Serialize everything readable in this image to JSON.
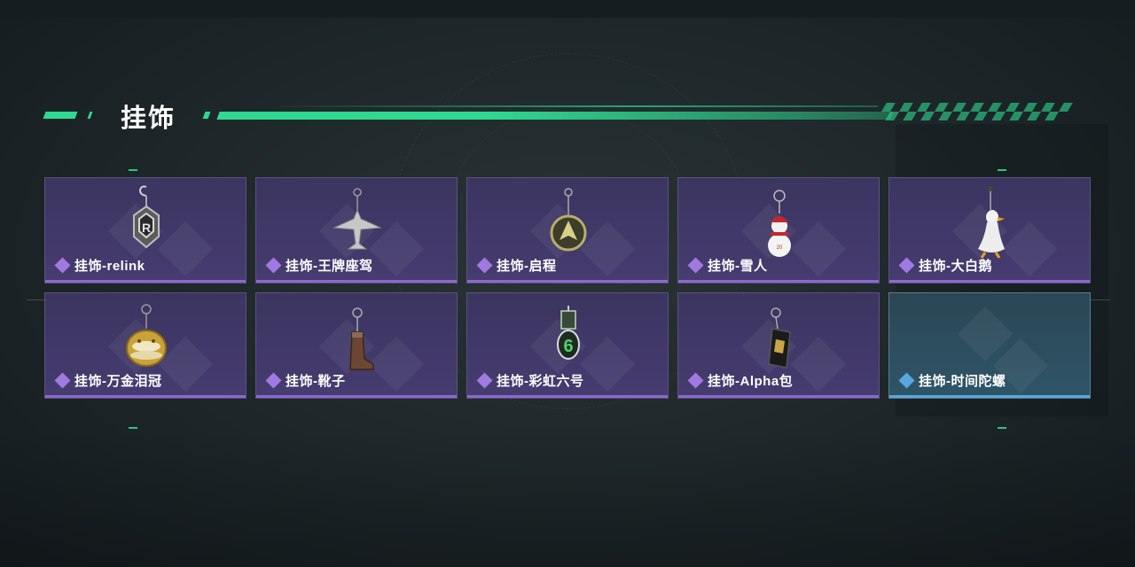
{
  "header": {
    "title": "挂饰"
  },
  "items": [
    {
      "label": "挂饰-relink",
      "rarity": "purple",
      "icon": "relink-charm-icon"
    },
    {
      "label": "挂饰-王牌座驾",
      "rarity": "purple",
      "icon": "jet-plane-charm-icon"
    },
    {
      "label": "挂饰-启程",
      "rarity": "purple",
      "icon": "compass-badge-charm-icon"
    },
    {
      "label": "挂饰-雪人",
      "rarity": "purple",
      "icon": "snowman-charm-icon"
    },
    {
      "label": "挂饰-大白鹅",
      "rarity": "purple",
      "icon": "white-goose-charm-icon"
    },
    {
      "label": "挂饰-万金泪冠",
      "rarity": "purple",
      "icon": "golden-crown-charm-icon"
    },
    {
      "label": "挂饰-靴子",
      "rarity": "purple",
      "icon": "boot-charm-icon"
    },
    {
      "label": "挂饰-彩虹六号",
      "rarity": "purple",
      "icon": "rainbow-six-charm-icon"
    },
    {
      "label": "挂饰-Alpha包",
      "rarity": "purple",
      "icon": "alpha-pack-charm-icon"
    },
    {
      "label": "挂饰-时间陀螺",
      "rarity": "blue",
      "icon": "time-spinner-icon"
    }
  ],
  "colors": {
    "accent": "#2fd890",
    "purple_rarity": "#8e67cf",
    "blue_rarity": "#5aa8dc"
  }
}
